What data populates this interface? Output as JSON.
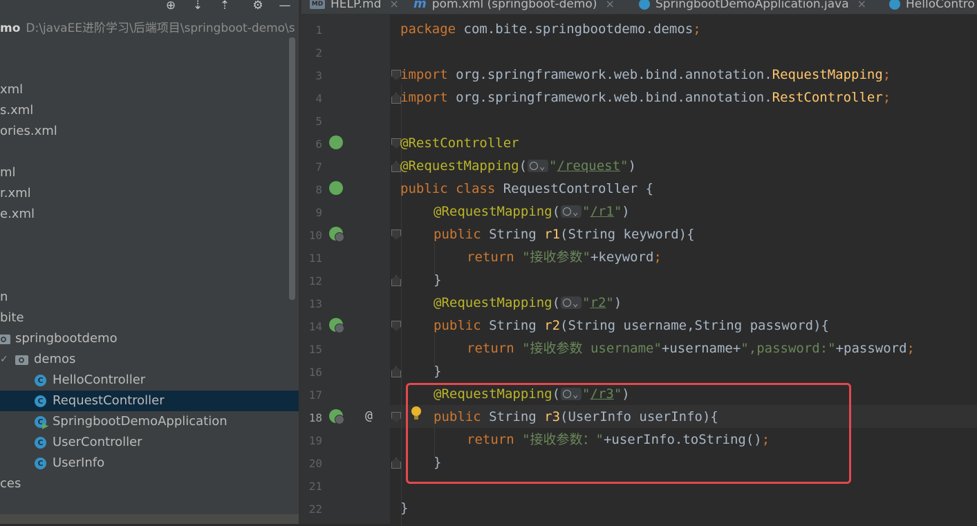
{
  "project": {
    "root_name": "mo",
    "root_path": "D:\\javaEE进阶学习\\后端项目\\springboot-demo\\s",
    "rows": [
      {
        "label": "xml"
      },
      {
        "label": "s.xml"
      },
      {
        "label": "ories.xml"
      },
      {
        "label": "ml"
      },
      {
        "label": "r.xml"
      },
      {
        "label": "e.xml"
      },
      {
        "label": "n"
      },
      {
        "label": "bite"
      },
      {
        "label": "springbootdemo"
      },
      {
        "label": "demos"
      },
      {
        "label": "HelloController"
      },
      {
        "label": "RequestController"
      },
      {
        "label": "SpringbootDemoApplication"
      },
      {
        "label": "UserController"
      },
      {
        "label": "UserInfo"
      },
      {
        "label": "ces"
      }
    ],
    "class_icon_letter": "C"
  },
  "tabs": [
    {
      "label": "HELP.md",
      "icon": "md-file-icon",
      "icon_text": "MD"
    },
    {
      "label": "pom.xml (springboot-demo)",
      "icon": "maven-icon",
      "icon_text": "m"
    },
    {
      "label": "SpringbootDemoApplication.java",
      "icon": "java-app-icon"
    },
    {
      "label": "HelloContro",
      "icon": "java-class-icon"
    }
  ],
  "tab_close": "×",
  "editor": {
    "line_numbers": [
      "1",
      "2",
      "3",
      "4",
      "5",
      "6",
      "7",
      "8",
      "9",
      "10",
      "11",
      "12",
      "13",
      "14",
      "15",
      "16",
      "17",
      "18",
      "19",
      "20",
      "21",
      "22"
    ],
    "lines": {
      "l1": {
        "kw": "package",
        "rest": " com.bite.springbootdemo.demos",
        "semi": ";"
      },
      "l3": {
        "kw": "import",
        "rest": " org.springframework.web.bind.annotation.",
        "cls": "RequestMapping",
        "semi": ";"
      },
      "l4": {
        "kw": "import",
        "rest": " org.springframework.web.bind.annotation.",
        "cls": "RestController",
        "semi": ";"
      },
      "l6": {
        "ann": "@RestController"
      },
      "l7": {
        "ann": "@RequestMapping",
        "open": "(",
        "q1": "\"",
        "url": "/request",
        "q2": "\"",
        "close": ")"
      },
      "l8": {
        "kw": "public class",
        "rest": " RequestController {"
      },
      "l9": {
        "ann": "@RequestMapping",
        "open": "(",
        "q1": "\"",
        "url": "/r1",
        "q2": "\"",
        "close": ")"
      },
      "l10": {
        "kw": "public",
        "t1": " String ",
        "fn": "r1",
        "rest": "(String keyword){"
      },
      "l11": {
        "kw": "return",
        "str": " \"接收参数\"",
        "rest": "+keyword",
        "semi": ";"
      },
      "l12": {
        "rest": "}"
      },
      "l13": {
        "ann": "@RequestMapping",
        "open": "(",
        "q1": "\"",
        "url": "r2",
        "q2": "\"",
        "close": ")"
      },
      "l14": {
        "kw": "public",
        "t1": " String ",
        "fn": "r2",
        "rest": "(String username,String password){"
      },
      "l15": {
        "kw": "return",
        "str": " \"接收参数 username\"",
        "rest": "+username+",
        "str2": "\",password:\"",
        "rest2": "+password",
        "semi": ";"
      },
      "l16": {
        "rest": "}"
      },
      "l17": {
        "ann": "@RequestMapping",
        "open": "(",
        "q1": "\"",
        "url": "/r3",
        "q2": "\"",
        "close": ")"
      },
      "l18": {
        "kw": "public",
        "t1": " String ",
        "fn": "r3",
        "rest": "(UserInfo userInfo){"
      },
      "l19": {
        "kw": "return",
        "str": " \"接收参数：\"",
        "rest": "+userInfo.toString()",
        "semi": ";"
      },
      "l20": {
        "rest": "}"
      },
      "l22": {
        "rest": "}"
      }
    },
    "at_symbol": "@"
  },
  "colors": {
    "highlight_box": "#e5484d",
    "selected_row": "#0d293e",
    "keyword": "#cc7832",
    "annotation": "#bbb529",
    "string": "#6a8759"
  }
}
